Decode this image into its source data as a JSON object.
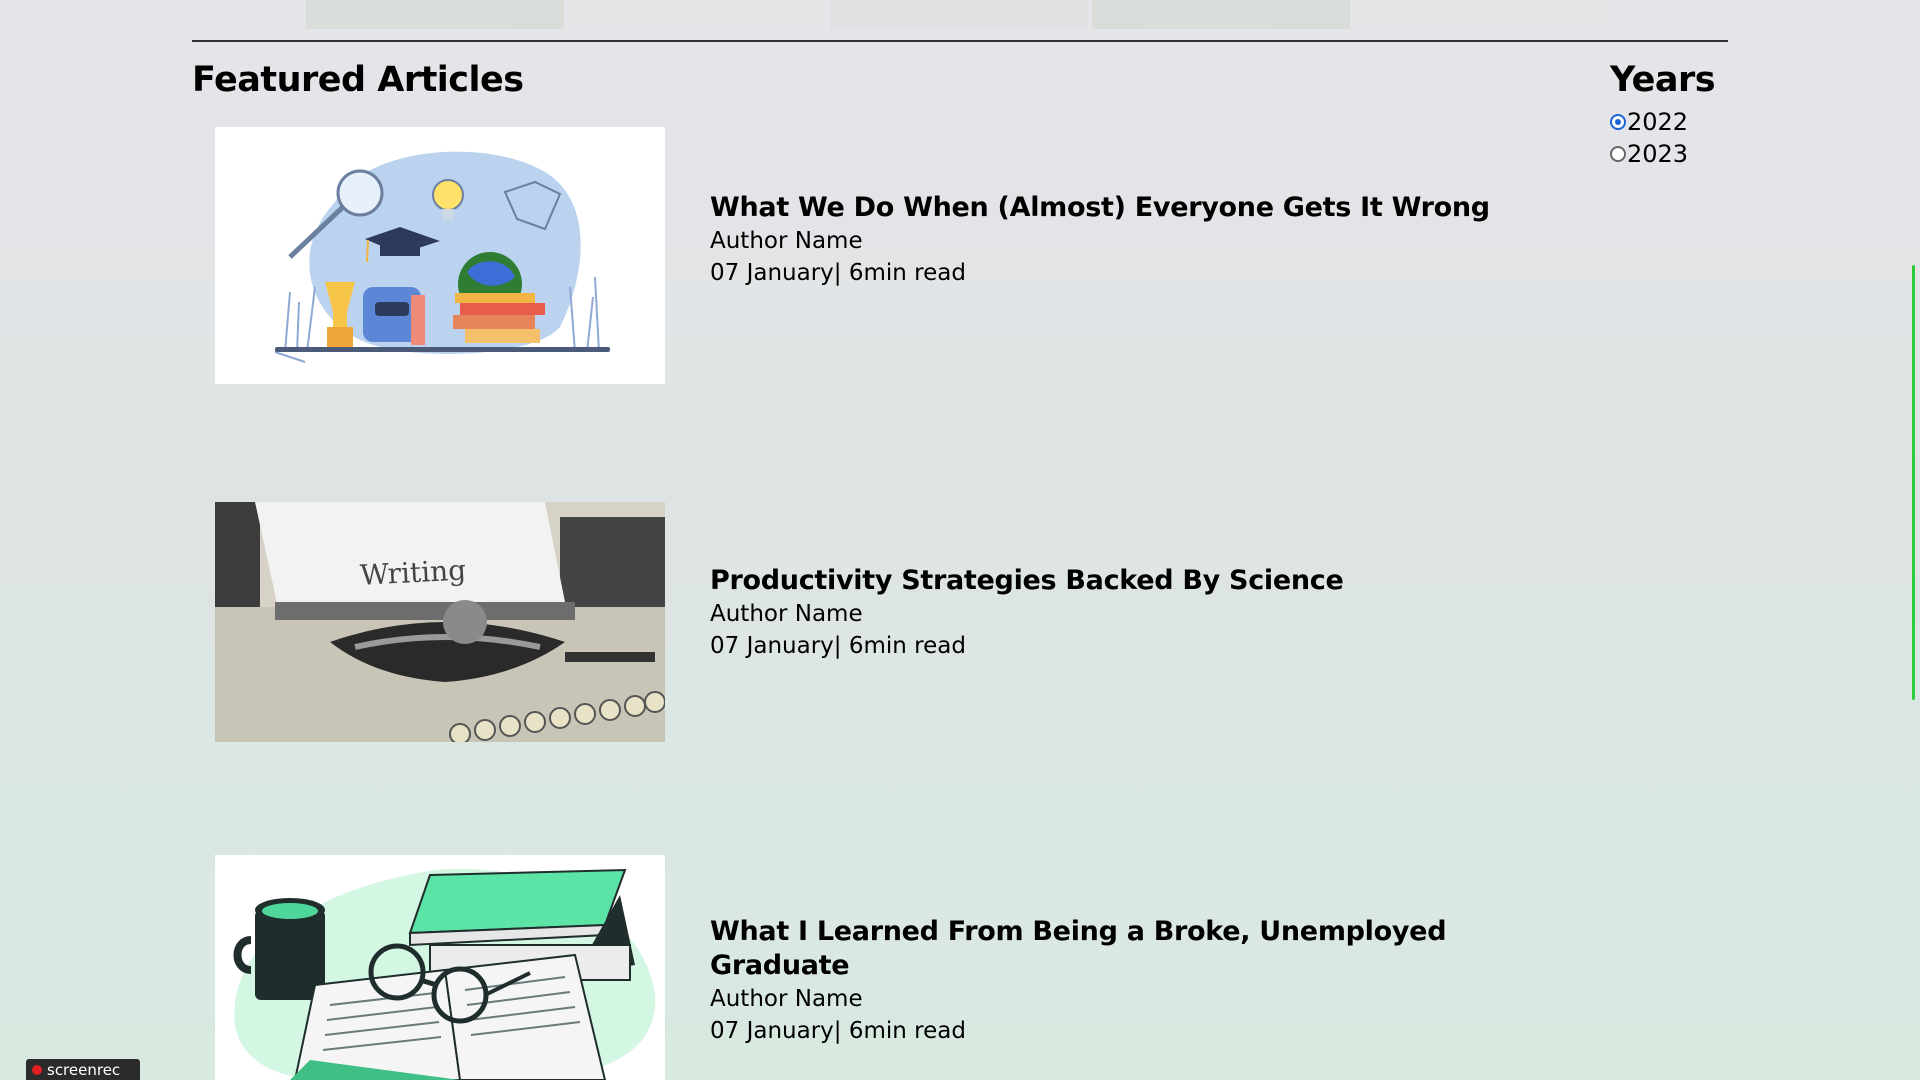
{
  "section": {
    "title": "Featured Articles"
  },
  "filters": {
    "title": "Years",
    "options": [
      {
        "label": "2022",
        "checked": true
      },
      {
        "label": "2023",
        "checked": false
      }
    ]
  },
  "articles": [
    {
      "title": "What We Do When (Almost) Everyone Gets It Wrong",
      "author": "Author Name",
      "meta": "07 January| 6min read",
      "image_subject": "education illustration with graduation cap, globe, books, trophy and backpack"
    },
    {
      "title": "Productivity Strategies Backed By Science",
      "author": "Author Name",
      "meta": "07 January| 6min read",
      "image_subject": "photo of a typewriter with paper reading Writing",
      "image_text": "Writing"
    },
    {
      "title": "What I Learned From Being a Broke, Unemployed Graduate",
      "author": "Author Name",
      "meta": "07 January| 6min read",
      "image_subject": "illustration of mug, books and glasses on open book"
    }
  ],
  "badge": {
    "label": "screenrec"
  },
  "colors": {
    "radio_accent": "#1a64d8",
    "scroll_indicator": "#2ecc3a",
    "book_green": "#5ce3a6"
  }
}
